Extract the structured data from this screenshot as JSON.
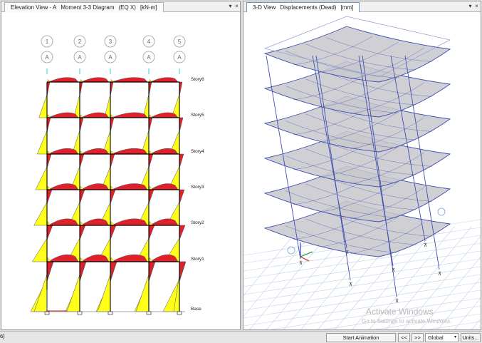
{
  "left_pane": {
    "tab_title": "Elevation View - A",
    "tab_subtitle": "Moment 3-3 Diagram",
    "tab_case": "(EQ X)",
    "tab_units": "[kN-m]",
    "grid_bubbles": [
      "1",
      "2",
      "3",
      "4",
      "5"
    ],
    "grid_letters": [
      "A",
      "A",
      "A",
      "A",
      "A"
    ],
    "story_labels": [
      "Story6",
      "Story5",
      "Story4",
      "Story3",
      "Story2",
      "Story1",
      "Base"
    ]
  },
  "right_pane": {
    "tab_title": "3-D View",
    "tab_subtitle": "Displacements (Dead)",
    "tab_units": "[mm]"
  },
  "pane_controls": {
    "dropdown_glyph": "▾",
    "close_glyph": "×"
  },
  "watermark": {
    "line1": "Activate Windows",
    "line2": "Go to Settings to activate Windows."
  },
  "statusbar": {
    "left_text": "6]",
    "start_animation": "Start Animation",
    "prev": "<<",
    "next": ">>",
    "coord_system": "Global",
    "units": "Units..."
  },
  "colors": {
    "positive_moment": "#ffff1a",
    "negative_moment": "#e0202a",
    "frame_line": "#000000",
    "model_frame": "#3f4fb0",
    "slab_fill": "#c8c8cc",
    "grid_line": "#c0d0e8"
  },
  "icons": [
    "dropdown-icon",
    "close-icon",
    "axis-triad-icon",
    "support-icon"
  ]
}
